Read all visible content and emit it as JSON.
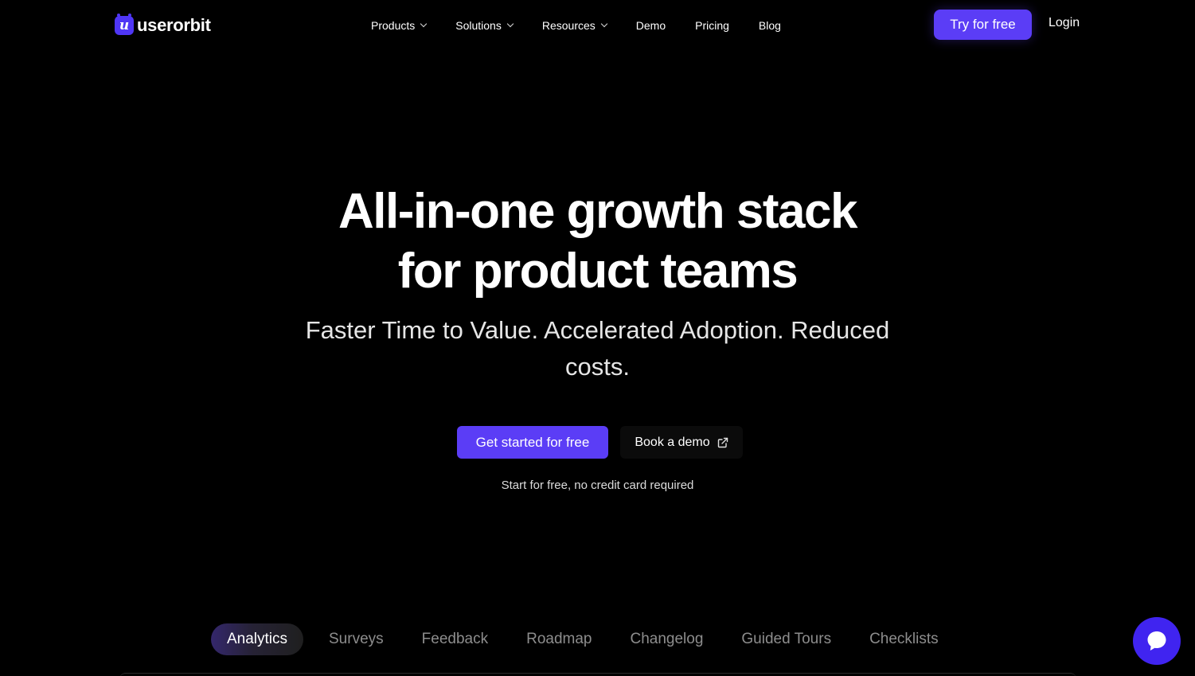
{
  "brand": {
    "name": "userorbit",
    "mark": "u",
    "accent": "#5b3df6"
  },
  "nav": {
    "items": [
      {
        "label": "Products",
        "has_dropdown": true
      },
      {
        "label": "Solutions",
        "has_dropdown": true
      },
      {
        "label": "Resources",
        "has_dropdown": true
      },
      {
        "label": "Demo",
        "has_dropdown": false
      },
      {
        "label": "Pricing",
        "has_dropdown": false
      },
      {
        "label": "Blog",
        "has_dropdown": false
      }
    ],
    "try_label": "Try for free",
    "login_label": "Login"
  },
  "hero": {
    "title_line1": "All-in-one growth stack",
    "title_line2": "for product teams",
    "subtitle": "Faster Time to Value. Accelerated Adoption. Reduced costs.",
    "cta_primary": "Get started for free",
    "cta_secondary": "Book a demo",
    "cta_secondary_icon": "external-link-icon",
    "note": "Start for free, no credit card required"
  },
  "tabs": {
    "active": "Analytics",
    "items": [
      {
        "label": "Analytics"
      },
      {
        "label": "Surveys"
      },
      {
        "label": "Feedback"
      },
      {
        "label": "Roadmap"
      },
      {
        "label": "Changelog"
      },
      {
        "label": "Guided Tours"
      },
      {
        "label": "Checklists"
      }
    ]
  },
  "chat": {
    "icon": "chat-bubble-icon",
    "color": "#4024f0"
  }
}
